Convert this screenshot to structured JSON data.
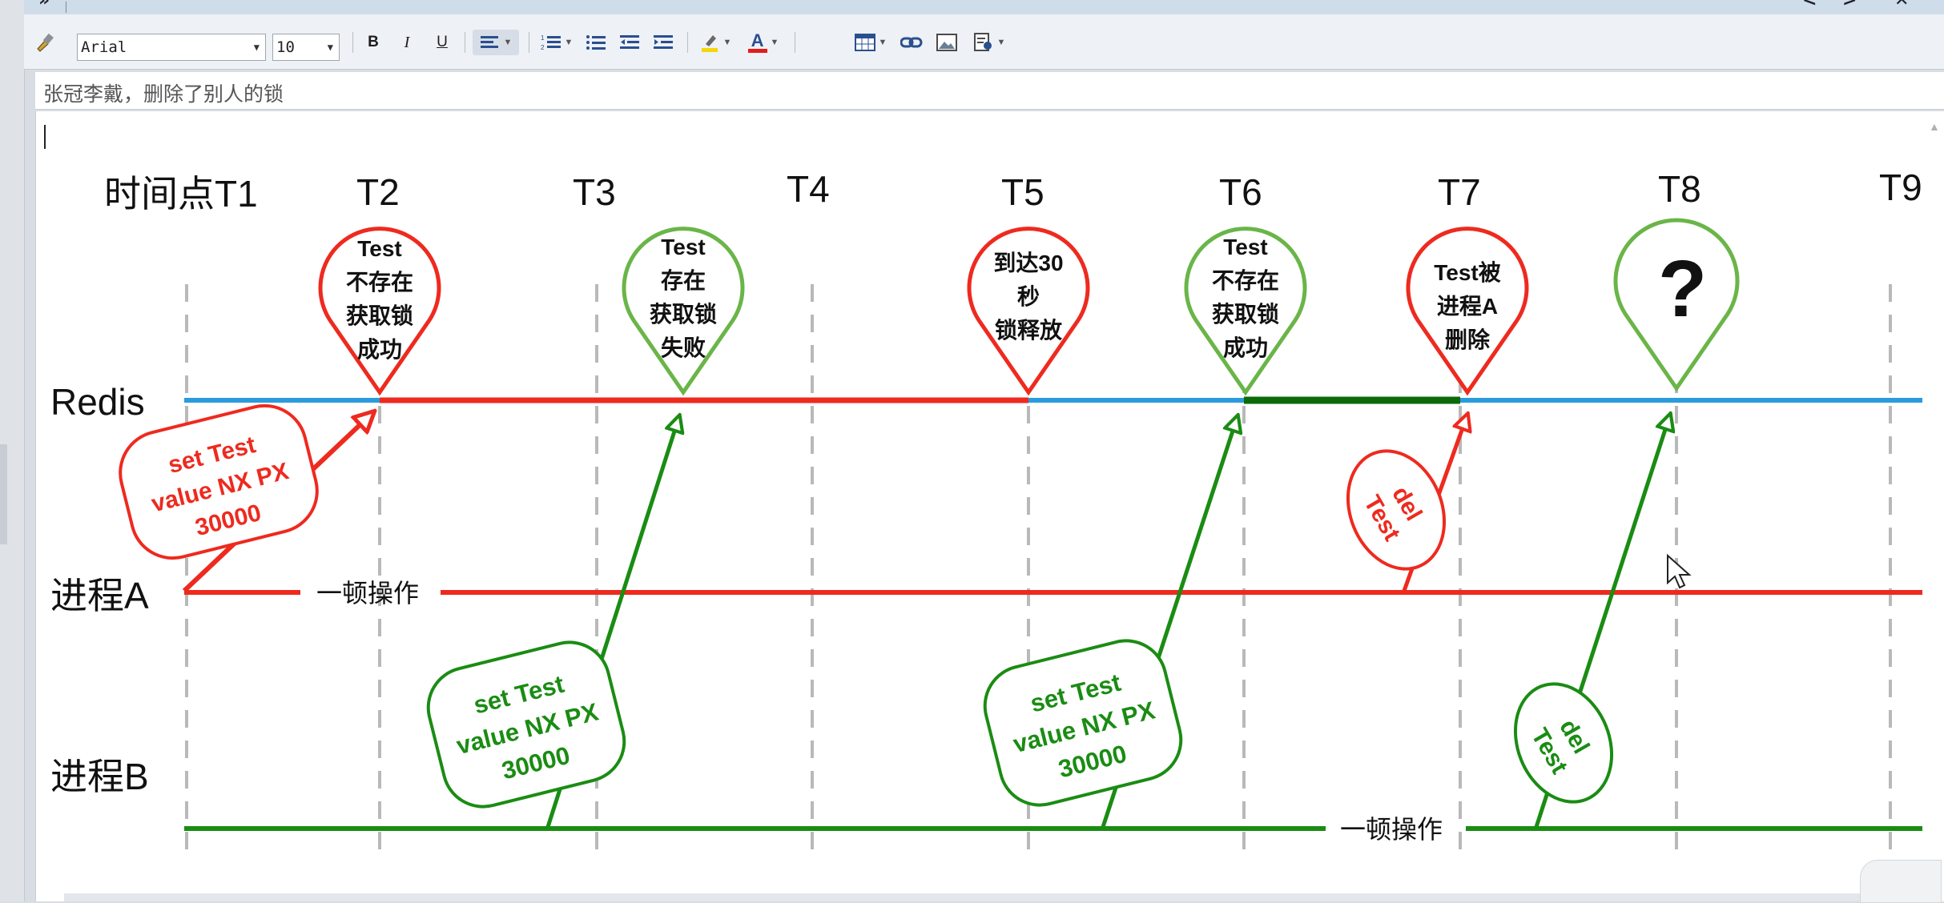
{
  "toolbar": {
    "font_name": "Arial",
    "font_size": "10",
    "bold_label": "B",
    "italic_label": "I",
    "underline_label": "U",
    "text_color_label": "A"
  },
  "subject": {
    "text": "张冠李戴，删除了别人的锁"
  },
  "colors": {
    "red": "#ee2a1f",
    "green": "#1a8c13",
    "light_green": "#6ab548",
    "blue": "#2b9bdc",
    "dark_green": "#0b6b0b",
    "gray": "#b9b9b9"
  },
  "diagram": {
    "time_points": [
      "时间点T1",
      "T2",
      "T3",
      "T4",
      "T5",
      "T6",
      "T7",
      "T8",
      "T9"
    ],
    "rows": {
      "redis": "Redis",
      "process_a": "进程A",
      "process_b": "进程B"
    },
    "pin_t2": [
      "Test",
      "不存在",
      "获取锁",
      "成功"
    ],
    "pin_t3": [
      "Test",
      "存在",
      "获取锁",
      "失败"
    ],
    "pin_t5": [
      "到达30",
      "秒",
      "锁释放"
    ],
    "pin_t6": [
      "Test",
      "不存在",
      "获取锁",
      "成功"
    ],
    "pin_t7": [
      "Test被",
      "进程A",
      "删除"
    ],
    "pin_t8": "?",
    "cmd_a_set": [
      "set  Test",
      "value  NX  PX",
      "30000"
    ],
    "cmd_b_set1": [
      "set  Test",
      "value  NX  PX",
      "30000"
    ],
    "cmd_b_set2": [
      "set  Test",
      "value  NX  PX",
      "30000"
    ],
    "cmd_a_del": [
      "del",
      "Test"
    ],
    "cmd_b_del": [
      "del",
      "Test"
    ],
    "pause_a": "一顿操作",
    "pause_b": "一顿操作"
  }
}
